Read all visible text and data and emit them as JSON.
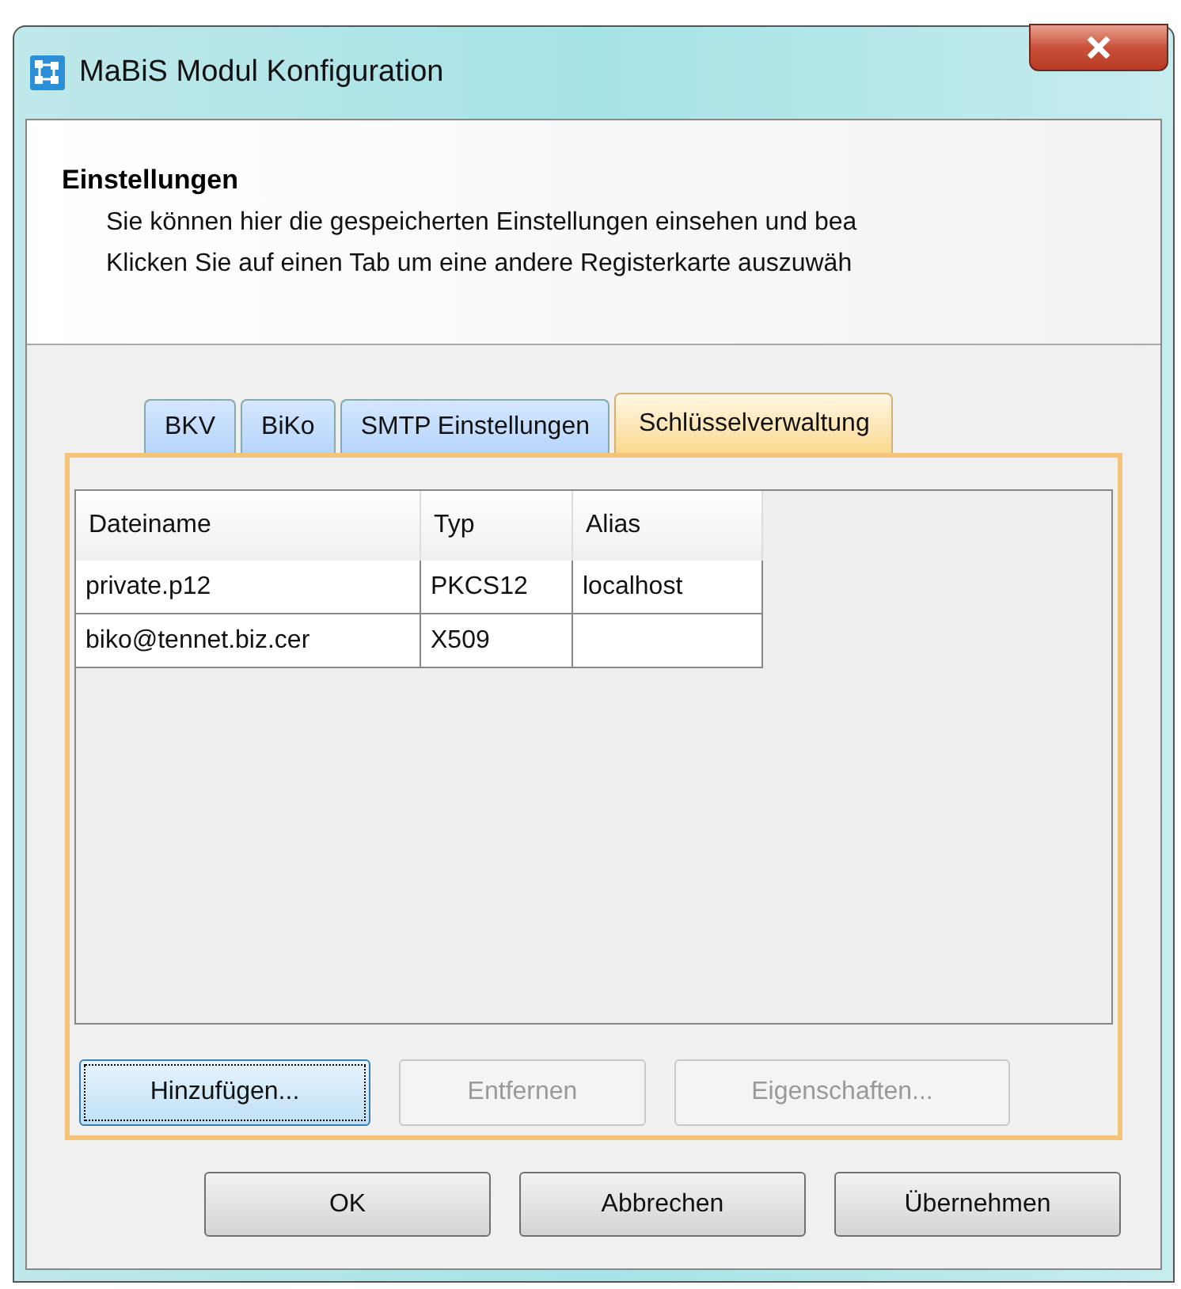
{
  "window": {
    "title": "MaBiS Modul Konfiguration"
  },
  "header": {
    "title": "Einstellungen",
    "lines": [
      "Sie können hier die gespeicherten Einstellungen einsehen und bea",
      "Klicken Sie auf einen Tab um eine andere Registerkarte auszuwäh"
    ]
  },
  "tabs": [
    {
      "label": "BKV",
      "selected": false
    },
    {
      "label": "BiKo",
      "selected": false
    },
    {
      "label": "SMTP Einstellungen",
      "selected": false
    },
    {
      "label": "Schlüsselverwaltung",
      "selected": true
    }
  ],
  "table": {
    "columns": [
      "Dateiname",
      "Typ",
      "Alias"
    ],
    "rows": [
      [
        "private.p12",
        "PKCS12",
        "localhost"
      ],
      [
        "biko@tennet.biz.cer",
        "X509",
        ""
      ]
    ]
  },
  "panel_buttons": [
    {
      "label": "Hinzufügen...",
      "disabled": false,
      "focused": true
    },
    {
      "label": "Entfernen",
      "disabled": true,
      "focused": false
    },
    {
      "label": "Eigenschaften...",
      "disabled": true,
      "focused": false
    }
  ],
  "dialog_buttons": [
    "OK",
    "Abbrechen",
    "Übernehmen"
  ]
}
